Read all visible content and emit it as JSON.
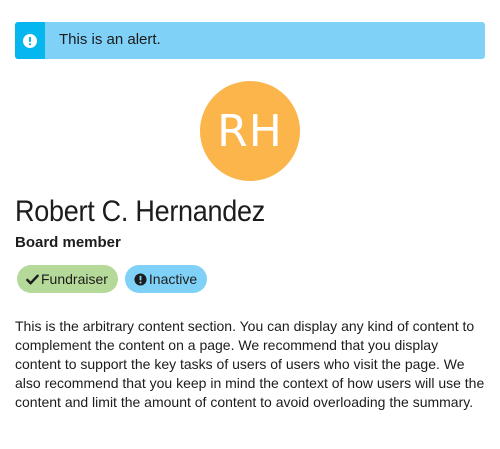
{
  "alert": {
    "text": "This is an alert.",
    "icon": "exclamation-circle-icon",
    "accent_color": "#06b6ee",
    "background_color": "#7fd1f8"
  },
  "profile": {
    "initials": "RH",
    "avatar_color": "#fbb54b",
    "name": "Robert C. Hernandez",
    "role": "Board member"
  },
  "badges": [
    {
      "label": "Fundraiser",
      "icon": "check-icon",
      "color": "#b4d998"
    },
    {
      "label": "Inactive",
      "icon": "exclamation-circle-icon",
      "color": "#7fd1f8"
    }
  ],
  "content": {
    "text": "This is the arbitrary content section. You can display any kind of content to complement the content on a page. We recommend that you display content to support the key tasks of users of users who visit the page. We also recommend that you keep in mind the context of how users will use the content and limit the amount of content to avoid overloading the summary."
  }
}
